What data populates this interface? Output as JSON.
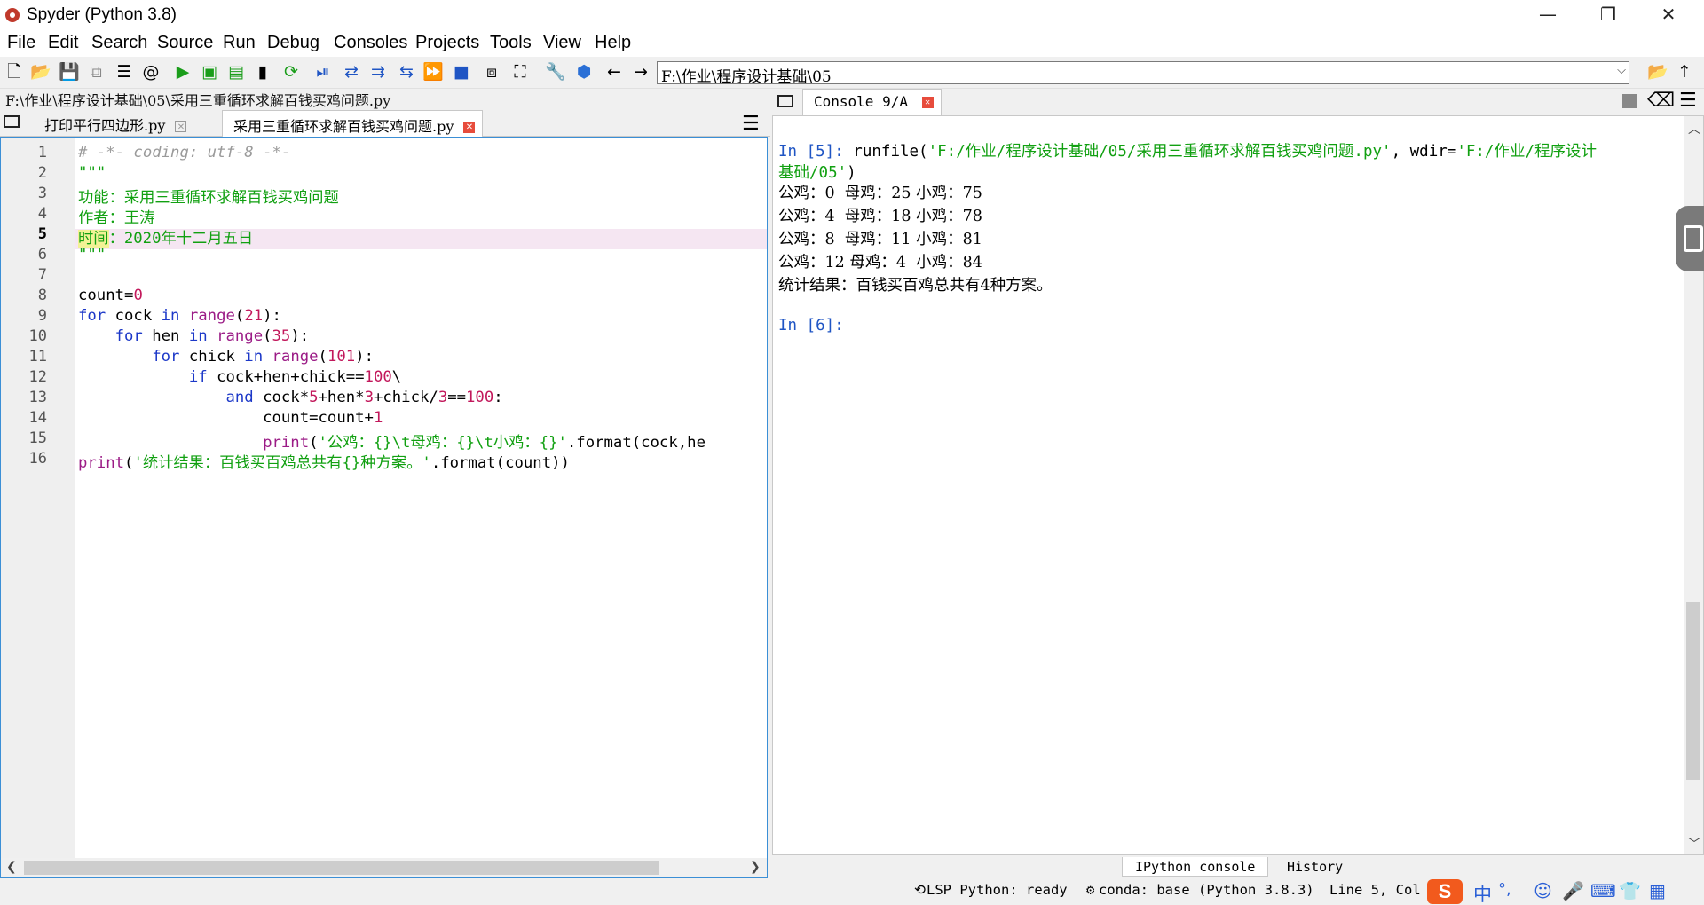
{
  "window": {
    "title": "Spyder (Python 3.8)",
    "controls": {
      "minimize": "—",
      "restore": "❐",
      "close": "✕"
    }
  },
  "menu": [
    "File",
    "Edit",
    "Search",
    "Source",
    "Run",
    "Debug",
    "Consoles",
    "Projects",
    "Tools",
    "View",
    "Help"
  ],
  "toolbar": {
    "working_dir": "F:\\作业\\程序设计基础\\05",
    "icons": [
      "new-file-icon",
      "open-file-icon",
      "save-icon",
      "save-all-icon",
      "outline-icon",
      "at-icon",
      "run-icon",
      "run-cell-icon",
      "run-cell-advance-icon",
      "run-selection-icon",
      "rerun-icon",
      "debug-icon",
      "step-icon",
      "step-into-icon",
      "step-return-icon",
      "continue-icon",
      "stop-icon",
      "maximize-pane-icon",
      "fullscreen-icon",
      "preferences-icon",
      "python-path-icon",
      "back-icon",
      "forward-icon",
      "browse-folder-icon",
      "parent-dir-icon"
    ]
  },
  "editor": {
    "file_path": "F:\\作业\\程序设计基础\\05\\采用三重循环求解百钱买鸡问题.py",
    "tabs": [
      {
        "label": "打印平行四边形.py",
        "active": false
      },
      {
        "label": "采用三重循环求解百钱买鸡问题.py",
        "active": true
      }
    ],
    "current_line": 5,
    "line_numbers": [
      "1",
      "2",
      "3",
      "4",
      "5",
      "6",
      "7",
      "8",
      "9",
      "10",
      "11",
      "12",
      "13",
      "14",
      "15",
      "16"
    ],
    "code": {
      "l1": "# -*- coding: utf-8 -*-",
      "l2": "\"\"\"",
      "l3": "功能：采用三重循环求解百钱买鸡问题",
      "l4": "作者：王涛",
      "l5a": "时间",
      "l5b": "：2020年十二月五日",
      "l6": "\"\"\"",
      "l8a": "count=",
      "l8b": "0",
      "l9a": "for",
      "l9b": " cock ",
      "l9c": "in",
      "l9d": " ",
      "l9e": "range",
      "l9f": "(",
      "l9g": "21",
      "l9h": "):",
      "l10a": "    for",
      "l10b": " hen ",
      "l10c": "in",
      "l10d": " ",
      "l10e": "range",
      "l10f": "(",
      "l10g": "35",
      "l10h": "):",
      "l11a": "        for",
      "l11b": " chick ",
      "l11c": "in",
      "l11d": " ",
      "l11e": "range",
      "l11f": "(",
      "l11g": "101",
      "l11h": "):",
      "l12a": "            if",
      "l12b": " cock+hen+chick==",
      "l12c": "100",
      "l12d": "\\",
      "l13a": "                and",
      "l13b": " cock*",
      "l13c": "5",
      "l13d": "+hen*",
      "l13e": "3",
      "l13f": "+chick/",
      "l13g": "3",
      "l13h": "==",
      "l13i": "100",
      "l13j": ":",
      "l14a": "                    count=count+",
      "l14b": "1",
      "l15a": "                    print",
      "l15b": "(",
      "l15c": "'公鸡：{}\\t母鸡：{}\\t小鸡：{}'",
      "l15d": ".format(cock,he",
      "l16a": "print",
      "l16b": "(",
      "l16c": "'统计结果：百钱买百鸡总共有{}种方案。'",
      "l16d": ".format(count))"
    }
  },
  "console": {
    "tab_label": "Console 9/A",
    "input_prompt": "In [5]: ",
    "cmd_fn": "runfile(",
    "cmd_arg1": "'F:/作业/程序设计基础/05/采用三重循环求解百钱买鸡问题.py'",
    "cmd_mid": ", wdir=",
    "cmd_arg2a": "'F:/作业/程序设计",
    "cmd_arg2b": "基础/05'",
    "cmd_end": ")",
    "output": [
      "公鸡：0  母鸡：25 小鸡：75",
      "公鸡：4  母鸡：18 小鸡：78",
      "公鸡：8  母鸡：11 小鸡：81",
      "公鸡：12 母鸡：4  小鸡：84",
      "统计结果：百钱买百鸡总共有4种方案。"
    ],
    "next_prompt": "In [6]:",
    "bottom_tabs": [
      "IPython console",
      "History"
    ]
  },
  "statusbar": {
    "lsp": "LSP Python: ready",
    "conda": "conda: base (Python 3.8.3)",
    "position": "Line 5, Col 1"
  },
  "ime": {
    "logo": "S",
    "mode": "中",
    "punct": "°,",
    "icons": [
      "emoji-icon",
      "mic-icon",
      "keyboard-icon",
      "clothes-icon",
      "grid-icon"
    ]
  },
  "colors": {
    "keyword": "#1c38c8",
    "string": "#11a011",
    "number": "#c2185b",
    "builtin": "#9b1b86",
    "comment": "#9a9a9a",
    "prompt": "#1f55c4",
    "current_line_bg": "#f5e6f2",
    "focus_border": "#3b8fd6"
  }
}
